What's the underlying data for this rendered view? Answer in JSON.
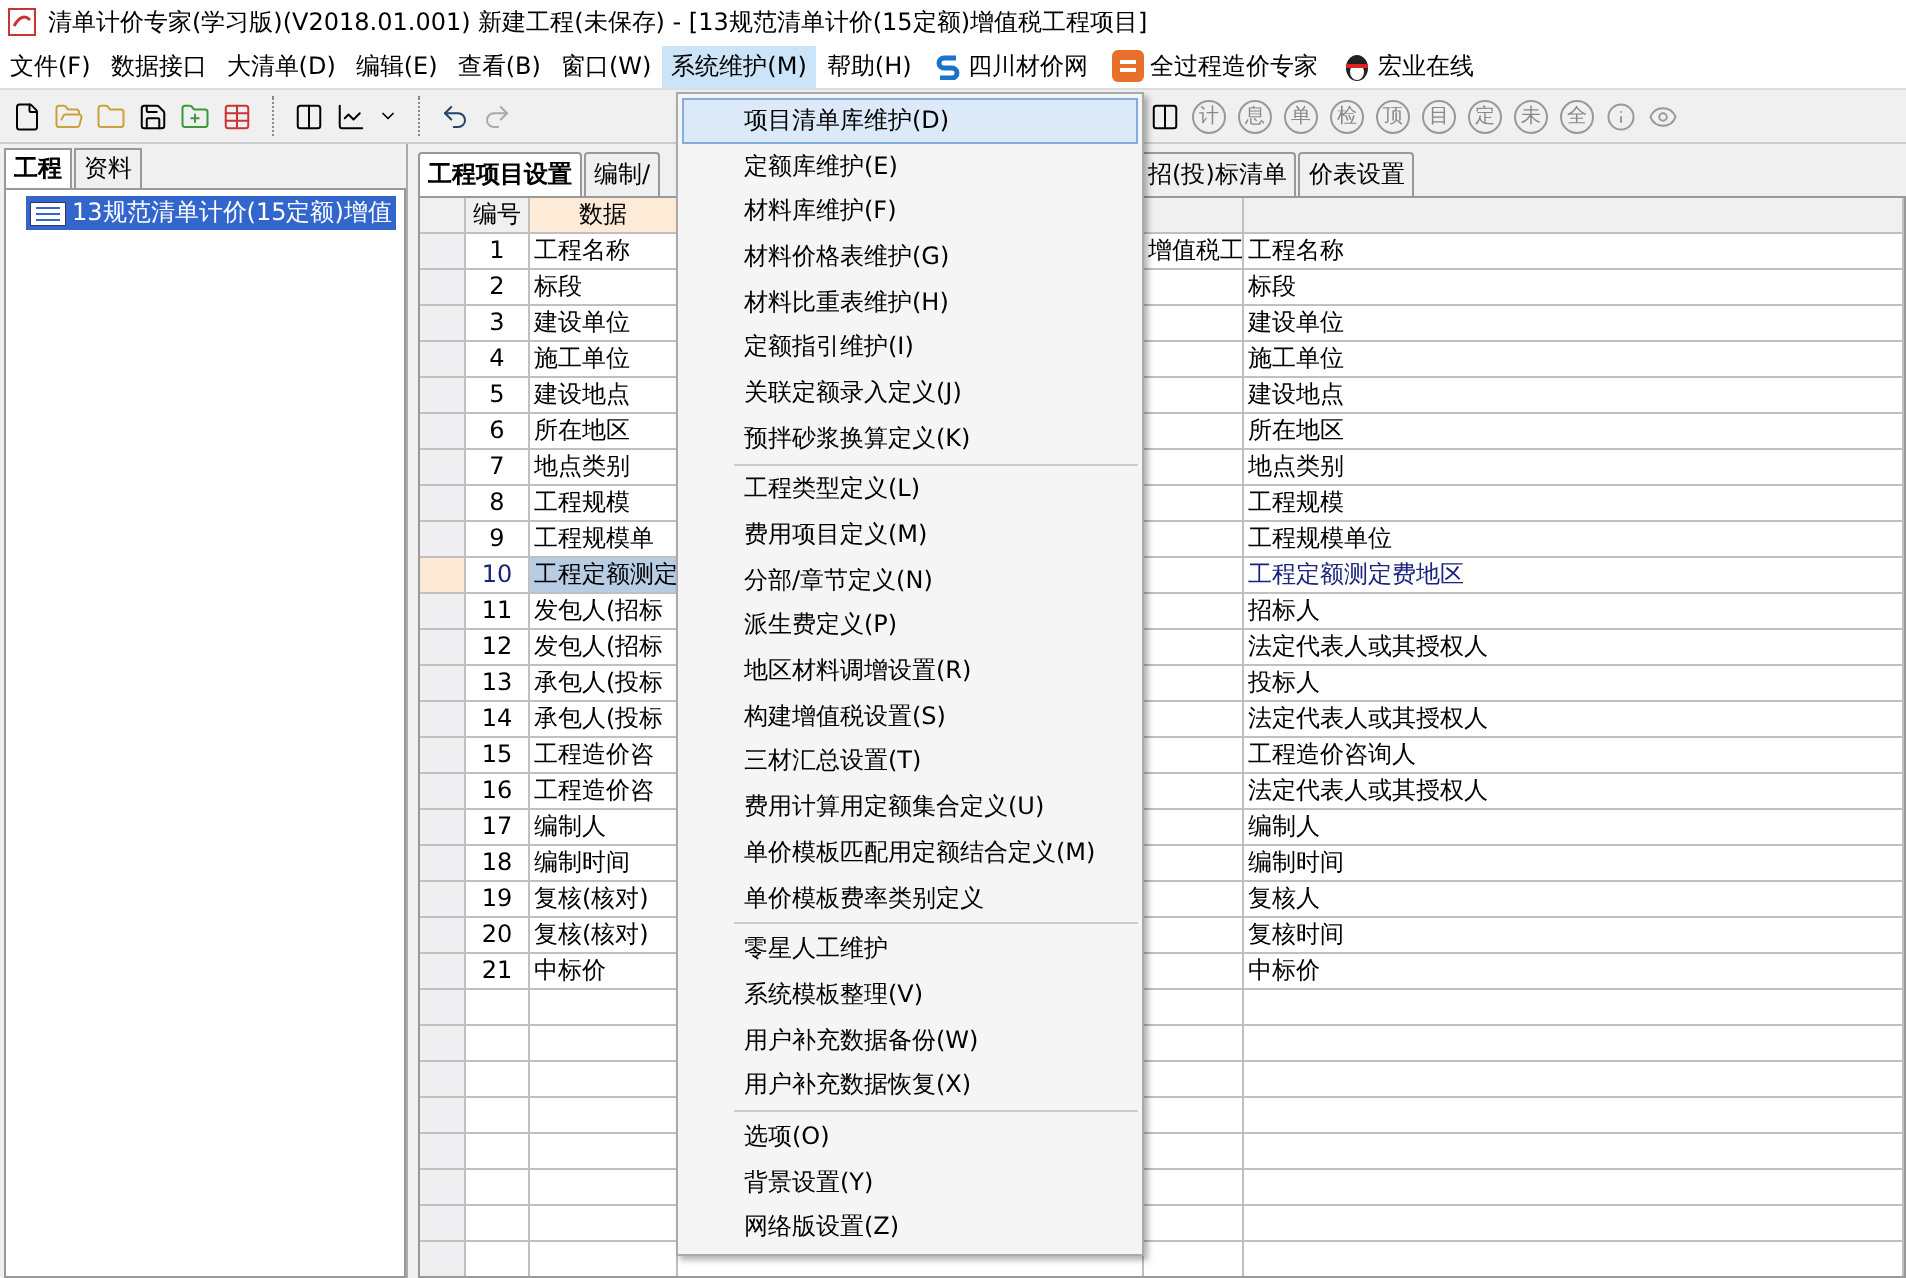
{
  "window": {
    "title": "清单计价专家(学习版)(V2018.01.001) 新建工程(未保存) - [13规范清单计价(15定额)增值税工程项目]"
  },
  "menu_bar": [
    {
      "label": "文件(F)",
      "selected": false
    },
    {
      "label": "数据接口",
      "selected": false
    },
    {
      "label": "大清单(D)",
      "selected": false
    },
    {
      "label": "编辑(E)",
      "selected": false
    },
    {
      "label": "查看(B)",
      "selected": false
    },
    {
      "label": "窗口(W)",
      "selected": false
    },
    {
      "label": "系统维护(M)",
      "selected": true
    },
    {
      "label": "帮助(H)",
      "selected": false
    }
  ],
  "links": [
    {
      "kind": "s",
      "label": "四川材价网"
    },
    {
      "kind": "e",
      "label": "全过程造价专家"
    },
    {
      "kind": "qq",
      "label": "宏业在线"
    }
  ],
  "toolbar_glyphs": [
    "计",
    "息",
    "单",
    "检",
    "顶",
    "目",
    "定",
    "未",
    "全"
  ],
  "left_tabs": [
    {
      "label": "工程",
      "selected": true
    },
    {
      "label": "资料",
      "selected": false
    }
  ],
  "tree": [
    {
      "label": "13规范清单计价(15定额)增值",
      "selected": true
    }
  ],
  "tabs": [
    {
      "label": "工程项目设置",
      "selected": true
    },
    {
      "label": "编制/",
      "selected": false
    },
    {
      "label": "招(投)标清单",
      "selected": false
    },
    {
      "label": "价表设置",
      "selected": false
    }
  ],
  "table": {
    "columns": [
      "编号",
      "数据"
    ],
    "rows": [
      {
        "no": "1",
        "name": "工程名称",
        "column_3": "增值税工",
        "value": "工程名称",
        "selected": false
      },
      {
        "no": "2",
        "name": "标段",
        "value": "标段",
        "selected": false
      },
      {
        "no": "3",
        "name": "建设单位",
        "value": "建设单位",
        "selected": false
      },
      {
        "no": "4",
        "name": "施工单位",
        "value": "施工单位",
        "selected": false
      },
      {
        "no": "5",
        "name": "建设地点",
        "value": "建设地点",
        "selected": false
      },
      {
        "no": "6",
        "name": "所在地区",
        "value": "所在地区",
        "selected": false
      },
      {
        "no": "7",
        "name": "地点类别",
        "value": "地点类别",
        "selected": false
      },
      {
        "no": "8",
        "name": "工程规模",
        "value": "工程规模",
        "selected": false
      },
      {
        "no": "9",
        "name": "工程规模单",
        "value": "工程规模单位",
        "selected": false
      },
      {
        "no": "10",
        "name": "工程定额测定",
        "value": "工程定额测定费地区",
        "selected": true
      },
      {
        "no": "11",
        "name": "发包人(招标",
        "value": "招标人",
        "selected": false
      },
      {
        "no": "12",
        "name": "发包人(招标",
        "value": "法定代表人或其授权人",
        "selected": false
      },
      {
        "no": "13",
        "name": "承包人(投标",
        "value": "投标人",
        "selected": false
      },
      {
        "no": "14",
        "name": "承包人(投标",
        "value": "法定代表人或其授权人",
        "selected": false
      },
      {
        "no": "15",
        "name": "工程造价咨",
        "value": "工程造价咨询人",
        "selected": false
      },
      {
        "no": "16",
        "name": "工程造价咨",
        "value": "法定代表人或其授权人",
        "selected": false
      },
      {
        "no": "17",
        "name": "编制人",
        "value": "编制人",
        "selected": false
      },
      {
        "no": "18",
        "name": "编制时间",
        "value": "编制时间",
        "selected": false
      },
      {
        "no": "19",
        "name": "复核(核对)",
        "value": "复核人",
        "selected": false
      },
      {
        "no": "20",
        "name": "复核(核对)",
        "value": "复核时间",
        "selected": false
      },
      {
        "no": "21",
        "name": "中标价",
        "value": "中标价",
        "selected": false
      }
    ]
  },
  "dropdown": {
    "groups": [
      [
        {
          "label": "项目清单库维护(D)",
          "selected": true
        },
        {
          "label": "定额库维护(E)",
          "selected": false
        },
        {
          "label": "材料库维护(F)",
          "selected": false
        },
        {
          "label": "材料价格表维护(G)",
          "selected": false
        },
        {
          "label": "材料比重表维护(H)",
          "selected": false
        },
        {
          "label": "定额指引维护(I)",
          "selected": false
        },
        {
          "label": "关联定额录入定义(J)",
          "selected": false
        },
        {
          "label": "预拌砂浆换算定义(K)",
          "selected": false
        }
      ],
      [
        {
          "label": "工程类型定义(L)",
          "selected": false
        },
        {
          "label": "费用项目定义(M)",
          "selected": false
        },
        {
          "label": "分部/章节定义(N)",
          "selected": false
        },
        {
          "label": "派生费定义(P)",
          "selected": false
        },
        {
          "label": "地区材料调增设置(R)",
          "selected": false
        },
        {
          "label": "构建增值税设置(S)",
          "selected": false
        },
        {
          "label": "三材汇总设置(T)",
          "selected": false
        },
        {
          "label": "费用计算用定额集合定义(U)",
          "selected": false
        },
        {
          "label": "单价模板匹配用定额结合定义(M)",
          "selected": false
        },
        {
          "label": "单价模板费率类别定义",
          "selected": false
        }
      ],
      [
        {
          "label": "零星人工维护",
          "selected": false
        },
        {
          "label": "系统模板整理(V)",
          "selected": false
        },
        {
          "label": "用户补充数据备份(W)",
          "selected": false
        },
        {
          "label": "用户补充数据恢复(X)",
          "selected": false
        }
      ],
      [
        {
          "label": "选项(O)",
          "selected": false
        },
        {
          "label": "背景设置(Y)",
          "selected": false
        },
        {
          "label": "网络版设置(Z)",
          "selected": false
        }
      ]
    ]
  }
}
